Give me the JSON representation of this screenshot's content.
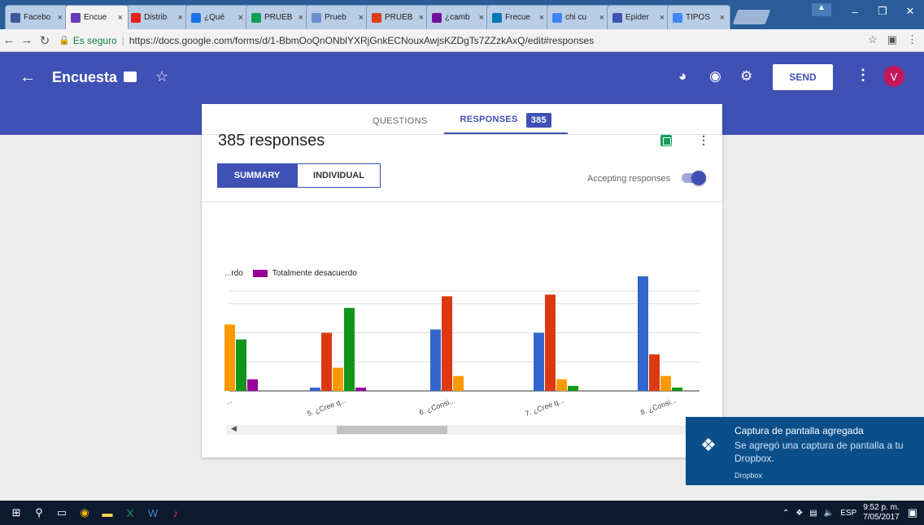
{
  "browser": {
    "tabs": [
      {
        "label": "Facebo",
        "color": "#3b5998",
        "active": false
      },
      {
        "label": "Encue",
        "color": "#673ab7",
        "active": true
      },
      {
        "label": "Distrib",
        "color": "#e62117",
        "active": false
      },
      {
        "label": "¿Qué",
        "color": "#1a73e8",
        "active": false
      },
      {
        "label": "PRUEB",
        "color": "#0f9d58",
        "active": false
      },
      {
        "label": "Prueb",
        "color": "#6b8fcf",
        "active": false
      },
      {
        "label": "PRUEB",
        "color": "#dc3e15",
        "active": false
      },
      {
        "label": "¿camb",
        "color": "#720e9e",
        "active": false
      },
      {
        "label": "Frecue",
        "color": "#0077b5",
        "active": false
      },
      {
        "label": "chi cu",
        "color": "#4285f4",
        "active": false
      },
      {
        "label": "Epider",
        "color": "#3f51b5",
        "active": false
      },
      {
        "label": "TIPOS",
        "color": "#4285f4",
        "active": false
      }
    ],
    "tab_close": "×",
    "window_controls": [
      "–",
      "❐",
      "✕"
    ],
    "secure_label": "Es seguro",
    "url": "https://docs.google.com/forms/d/1-BbmOoQnONblYXRjGnkECNouxAwjsKZDgTs7ZZzkAxQ/edit#responses"
  },
  "form_header": {
    "title": "Encuesta",
    "send_label": "SEND",
    "avatar_letter": "V",
    "accent": "#3f51b5"
  },
  "card": {
    "tab_questions": "QUESTIONS",
    "tab_responses": "RESPONSES",
    "response_count_badge": "385",
    "responses_title": "385 responses",
    "summary_label": "SUMMARY",
    "individual_label": "INDIVIDUAL",
    "accepting_label": "Accepting responses"
  },
  "chart_data": {
    "type": "bar",
    "legend": [
      {
        "name": "...rdo",
        "color": "#0f9618"
      },
      {
        "name": "Totalmente desacuerdo",
        "color": "#990099"
      }
    ],
    "categories": [
      "...",
      "5. ¿Cree q...",
      "6. ¿Consi...",
      "7. ¿Cree q...",
      "8. ¿Consi..."
    ],
    "series": [
      {
        "color": "#3366cc",
        "values": [
          null,
          2,
          37,
          35,
          69
        ]
      },
      {
        "color": "#dc3912",
        "values": [
          null,
          35,
          57,
          58,
          22
        ]
      },
      {
        "color": "#ff9900",
        "values": [
          40,
          14,
          9,
          7,
          9
        ]
      },
      {
        "color": "#109618",
        "values": [
          31,
          50,
          null,
          3,
          2
        ]
      },
      {
        "color": "#990099",
        "values": [
          7,
          2,
          null,
          null,
          null
        ]
      }
    ],
    "ylim": [
      0,
      70
    ],
    "grid": true
  },
  "toast": {
    "title": "Captura de pantalla agregada",
    "body": "Se agregó una captura de pantalla a tu Dropbox.",
    "source": "Dropbox"
  },
  "taskbar": {
    "lang": "ESP",
    "time": "9:52 p. m.",
    "date": "7/05/2017"
  }
}
